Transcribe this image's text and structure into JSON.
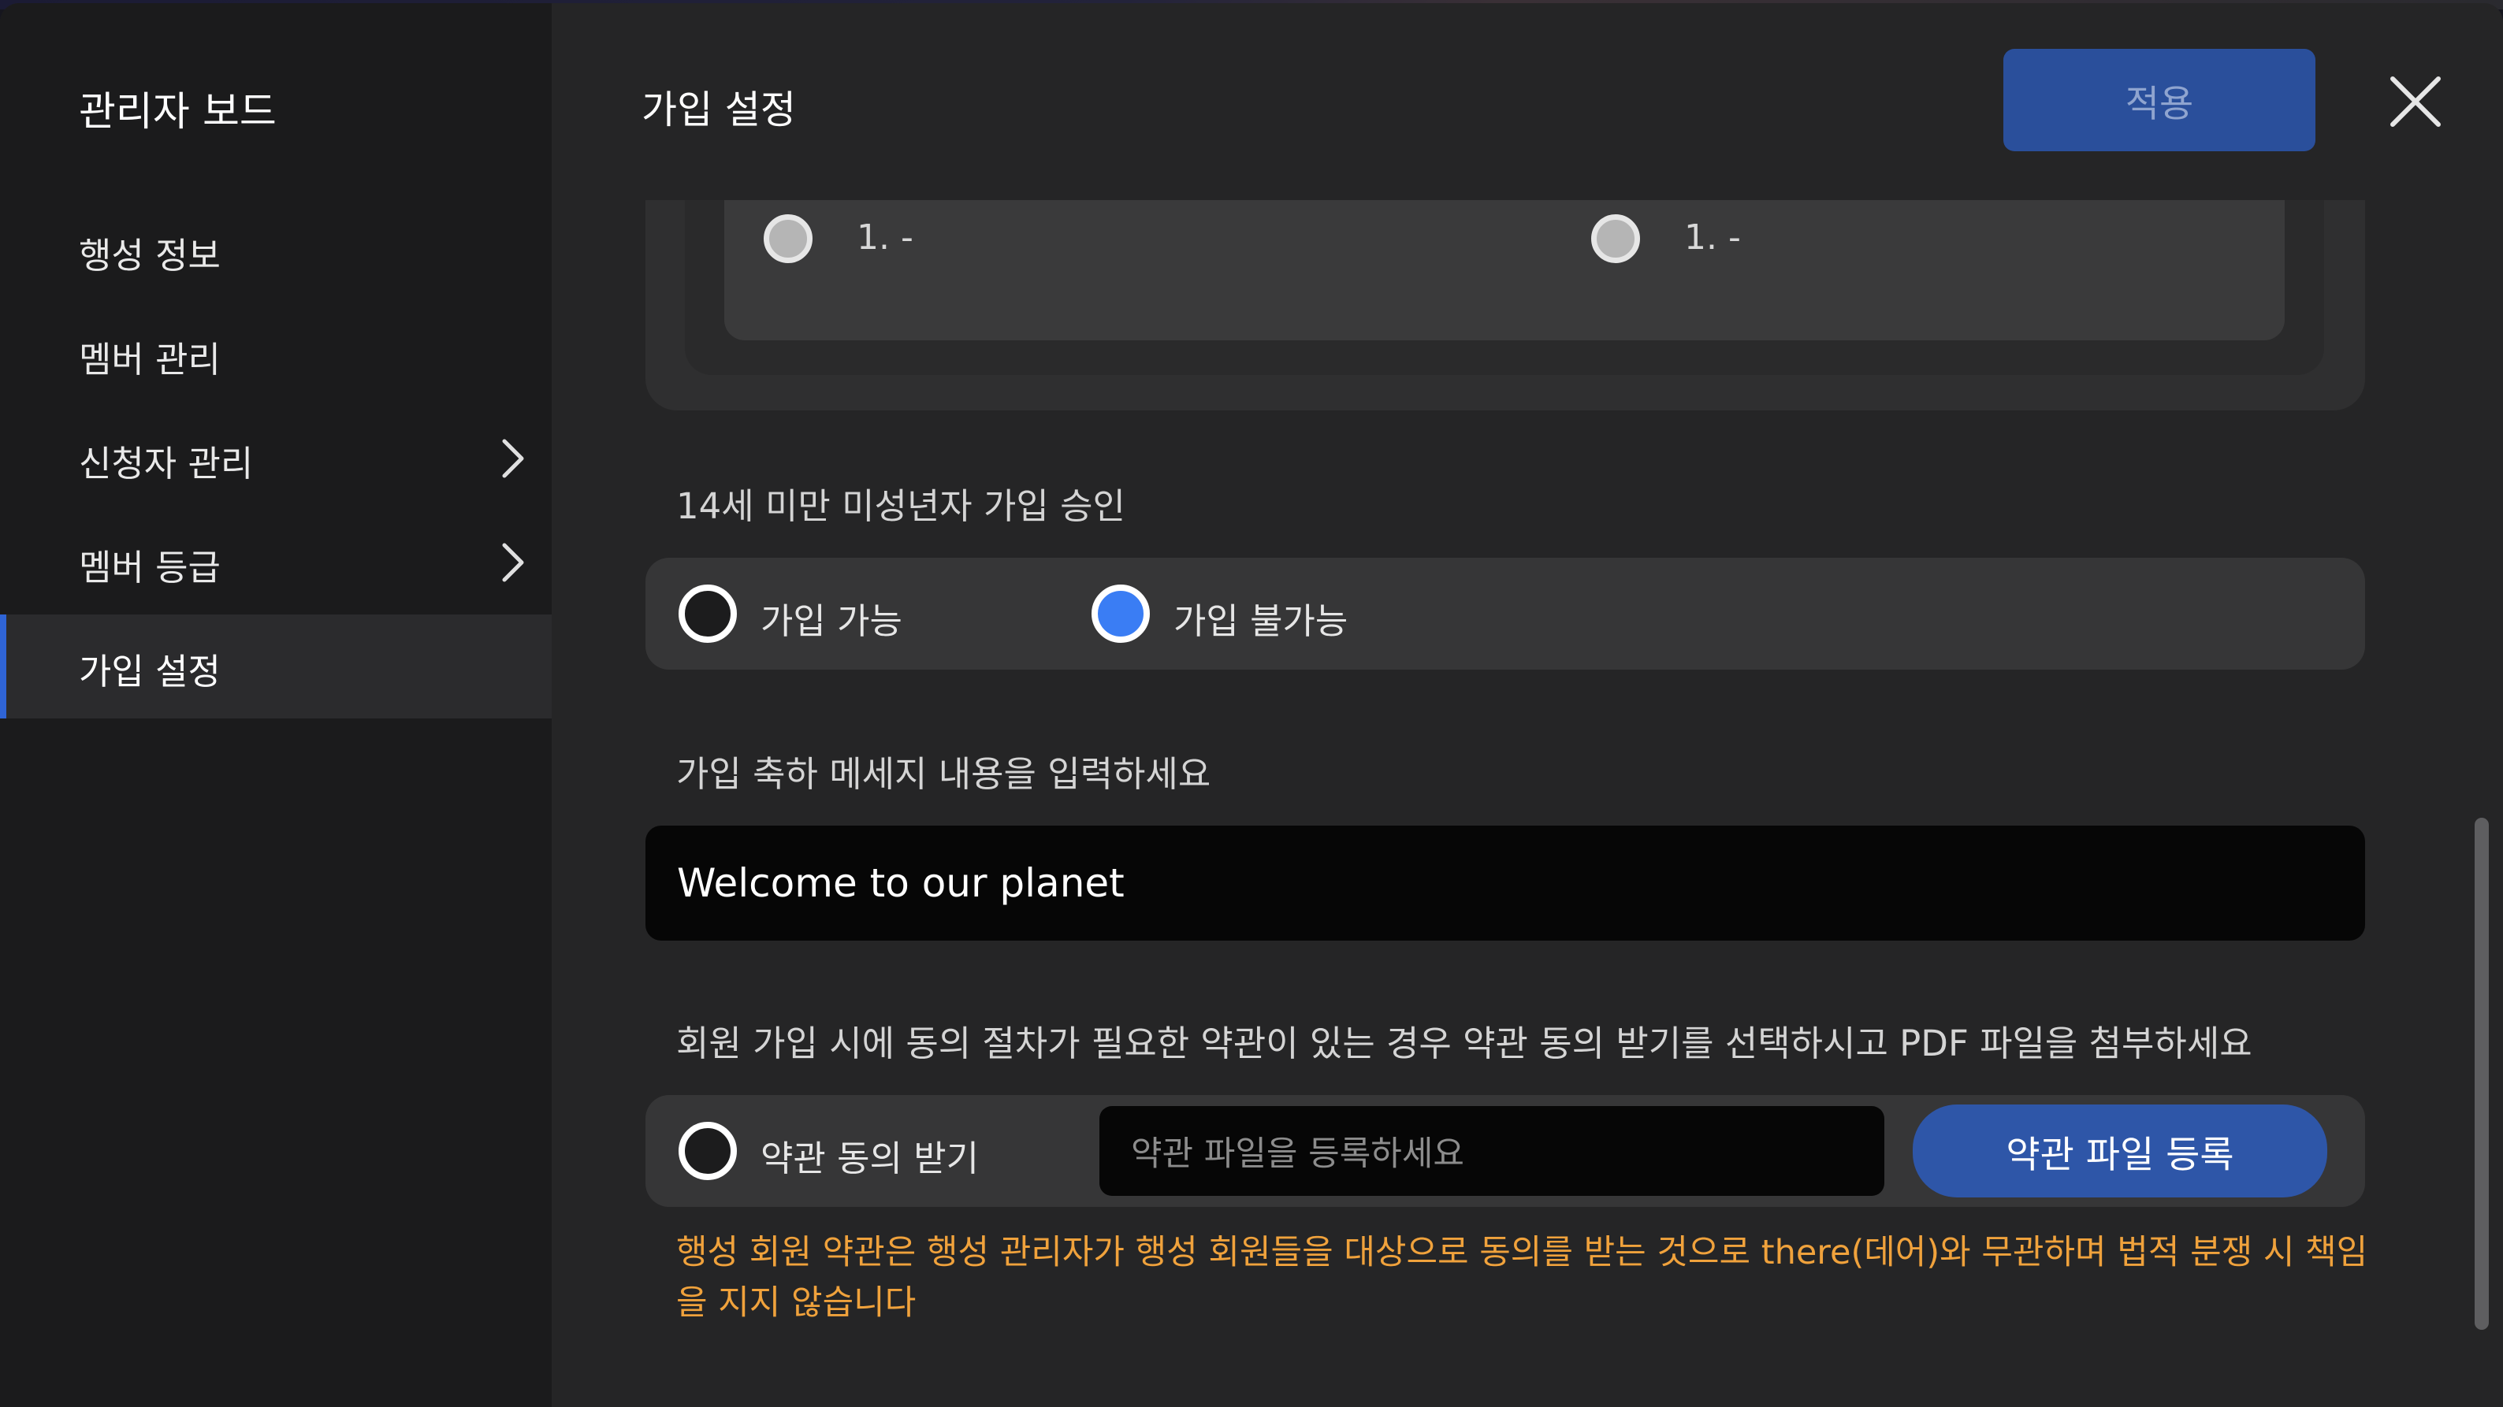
{
  "sidebar": {
    "title": "관리자 보드",
    "items": [
      {
        "label": "행성 정보"
      },
      {
        "label": "멤버 관리"
      },
      {
        "label": "신청자 관리"
      },
      {
        "label": "멤버 등급"
      },
      {
        "label": "가입 설정"
      }
    ]
  },
  "header": {
    "title": "가입 설정",
    "apply_label": "적용"
  },
  "top_options": [
    {
      "label": "1. -"
    },
    {
      "label": "1. -"
    }
  ],
  "minor_approval": {
    "label": "14세 미만 미성년자 가입 승인",
    "options": [
      {
        "label": "가입 가능"
      },
      {
        "label": "가입 불가능"
      }
    ],
    "selected": "가입 불가능"
  },
  "welcome": {
    "label": "가입 축하 메세지 내용을 입력하세요",
    "value": "Welcome to our planet"
  },
  "terms": {
    "label": "회원 가입 시에 동의 절차가 필요한 약관이 있는 경우 약관 동의 받기를 선택하시고 PDF 파일을 첨부하세요",
    "checkbox_label": "약관 동의 받기",
    "file_placeholder": "약관 파일을 등록하세요",
    "file_button": "약관 파일 등록",
    "warning": "행성 회원 약관은 행성 관리자가 행성 회원들을 대상으로 동의를 받는 것으로 there(데어)와 무관하며 법적 분쟁 시 책임을 지지 않습니다"
  },
  "colors": {
    "accent": "#3a7df4",
    "primary_button": "#2e56a8",
    "warning": "#f0a23c"
  }
}
